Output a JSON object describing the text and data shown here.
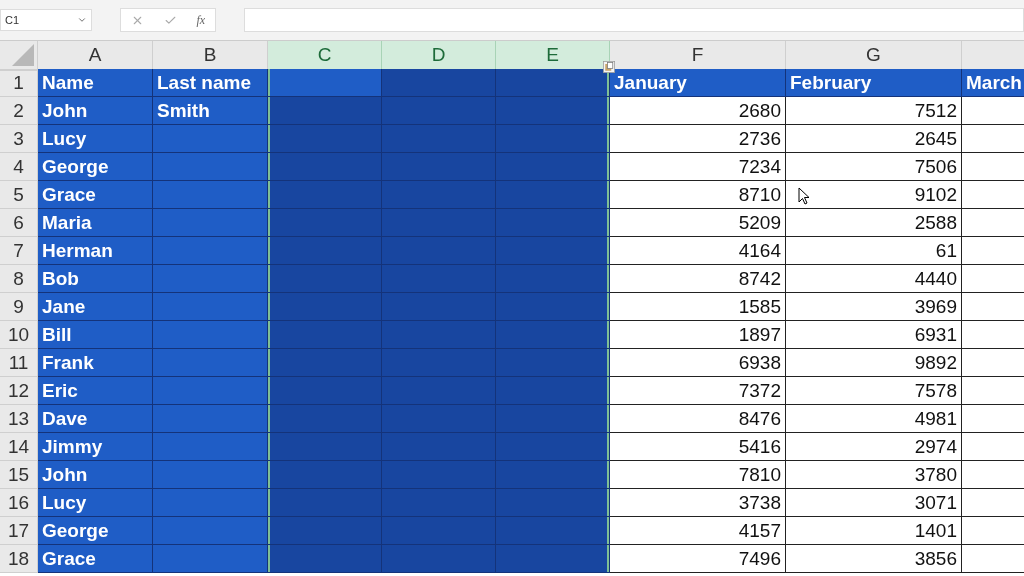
{
  "name_box": "C1",
  "formula_bar": {
    "function_label": "fx"
  },
  "columns": [
    {
      "letter": "A",
      "selected": false,
      "active": false,
      "highlighted": true
    },
    {
      "letter": "B",
      "selected": false,
      "active": false,
      "highlighted": true
    },
    {
      "letter": "C",
      "selected": true,
      "active": true,
      "highlighted": false
    },
    {
      "letter": "D",
      "selected": true,
      "active": false,
      "highlighted": false
    },
    {
      "letter": "E",
      "selected": true,
      "active": false,
      "highlighted": false
    },
    {
      "letter": "F",
      "selected": false,
      "active": false,
      "highlighted": false
    },
    {
      "letter": "G",
      "selected": false,
      "active": false,
      "highlighted": false
    },
    {
      "selected": false,
      "active": false,
      "highlighted": false
    }
  ],
  "rows": [
    {
      "number": "1",
      "highlighted": true,
      "active": true,
      "cells": {
        "A": "Name",
        "B": "Last name",
        "F": "January",
        "G": "February",
        "H": "March"
      }
    },
    {
      "number": "2",
      "highlighted": false,
      "cells": {
        "A": "John",
        "B": "Smith",
        "F": "2680",
        "G": "7512"
      }
    },
    {
      "number": "3",
      "highlighted": false,
      "cells": {
        "A": "Lucy",
        "F": "2736",
        "G": "2645"
      }
    },
    {
      "number": "4",
      "highlighted": false,
      "cells": {
        "A": "George",
        "F": "7234",
        "G": "7506"
      }
    },
    {
      "number": "5",
      "highlighted": false,
      "cells": {
        "A": "Grace",
        "F": "8710",
        "G": "9102"
      }
    },
    {
      "number": "6",
      "highlighted": false,
      "cells": {
        "A": "Maria",
        "F": "5209",
        "G": "2588"
      }
    },
    {
      "number": "7",
      "highlighted": false,
      "cells": {
        "A": "Herman",
        "F": "4164",
        "G": "61"
      }
    },
    {
      "number": "8",
      "highlighted": false,
      "cells": {
        "A": "Bob",
        "F": "8742",
        "G": "4440"
      }
    },
    {
      "number": "9",
      "highlighted": false,
      "cells": {
        "A": "Jane",
        "F": "1585",
        "G": "3969"
      }
    },
    {
      "number": "10",
      "highlighted": false,
      "cells": {
        "A": "Bill",
        "F": "1897",
        "G": "6931"
      }
    },
    {
      "number": "11",
      "highlighted": false,
      "cells": {
        "A": "Frank",
        "F": "6938",
        "G": "9892"
      }
    },
    {
      "number": "12",
      "highlighted": false,
      "cells": {
        "A": "Eric",
        "F": "7372",
        "G": "7578"
      }
    },
    {
      "number": "13",
      "highlighted": false,
      "cells": {
        "A": "Dave",
        "F": "8476",
        "G": "4981"
      }
    },
    {
      "number": "14",
      "highlighted": false,
      "cells": {
        "A": "Jimmy",
        "F": "5416",
        "G": "2974"
      }
    },
    {
      "number": "15",
      "highlighted": false,
      "cells": {
        "A": "John",
        "F": "7810",
        "G": "3780"
      }
    },
    {
      "number": "16",
      "highlighted": false,
      "cells": {
        "A": "Lucy",
        "F": "3738",
        "G": "3071"
      }
    },
    {
      "number": "17",
      "highlighted": false,
      "cells": {
        "A": "George",
        "F": "4157",
        "G": "1401"
      }
    },
    {
      "number": "18",
      "highlighted": false,
      "cells": {
        "A": "Grace",
        "F": "7496",
        "G": "3856"
      }
    }
  ]
}
